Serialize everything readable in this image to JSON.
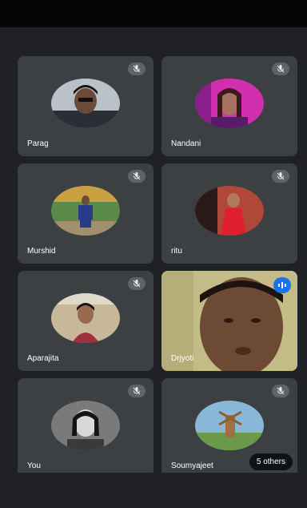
{
  "participants": [
    {
      "name": "Parag"
    },
    {
      "name": "Nandani"
    },
    {
      "name": "Murshid"
    },
    {
      "name": "ritu"
    },
    {
      "name": "Aparajita"
    },
    {
      "name": "Drjyoti"
    },
    {
      "name": "You"
    },
    {
      "name": "Soumyajeet"
    }
  ],
  "others_label": "5 others",
  "colors": {
    "background": "#202124",
    "tile": "#3c4043",
    "mute_badge": "#5f6368",
    "speaking_badge": "#1a73e8"
  },
  "icons": {
    "mute": "mic-off-icon",
    "speaking": "audio-level-icon"
  }
}
